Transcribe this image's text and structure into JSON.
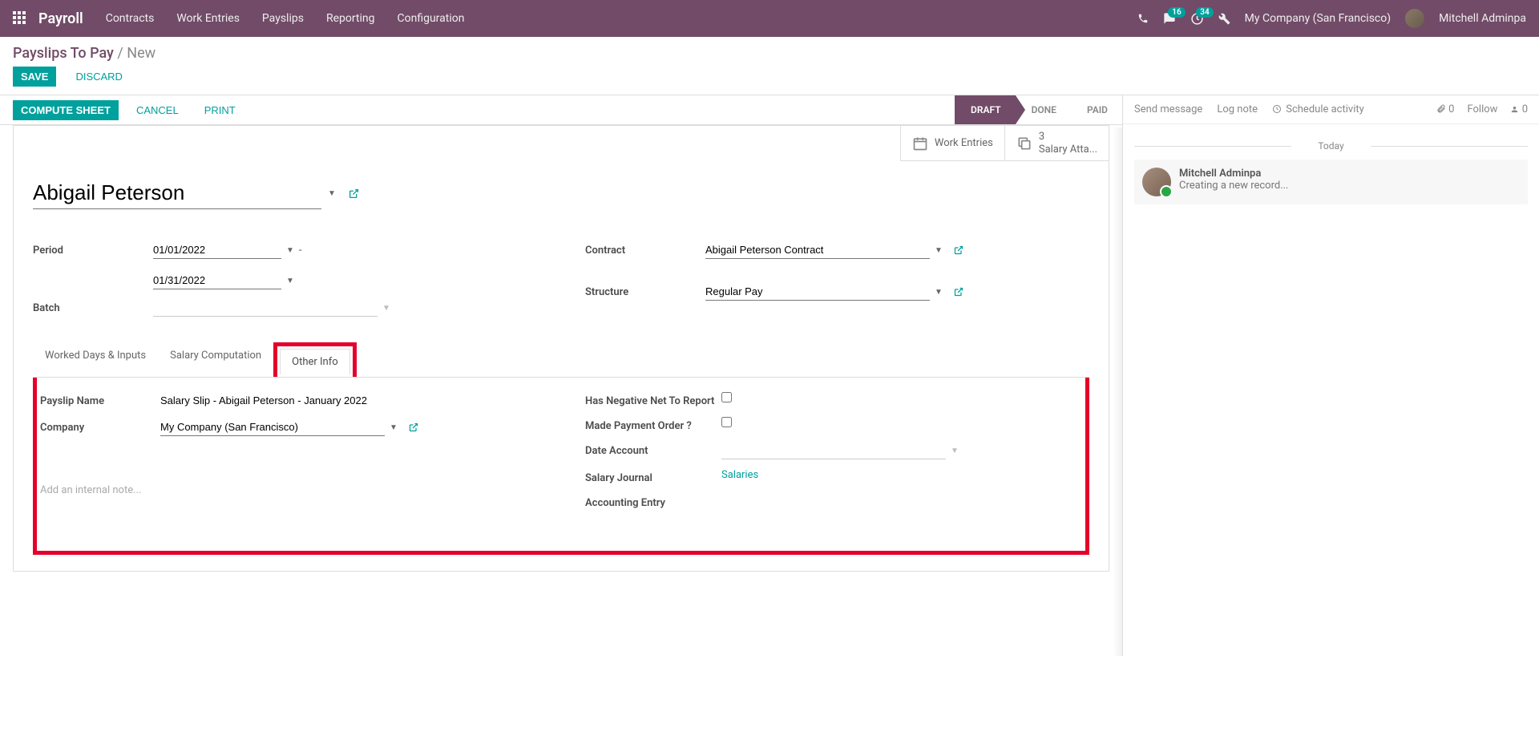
{
  "topbar": {
    "app_title": "Payroll",
    "menu": [
      "Contracts",
      "Work Entries",
      "Payslips",
      "Reporting",
      "Configuration"
    ],
    "msg_badge": "16",
    "call_badge": "34",
    "company": "My Company (San Francisco)",
    "user": "Mitchell Adminpa"
  },
  "breadcrumb": {
    "root": "Payslips To Pay",
    "current": "New"
  },
  "actions": {
    "save": "SAVE",
    "discard": "DISCARD"
  },
  "statusbar": {
    "compute": "COMPUTE SHEET",
    "cancel": "CANCEL",
    "print": "PRINT",
    "steps": [
      "DRAFT",
      "DONE",
      "PAID"
    ]
  },
  "stat_buttons": {
    "work_entries": "Work Entries",
    "salary_att_count": "3",
    "salary_att_label": "Salary Atta..."
  },
  "form": {
    "employee": "Abigail Peterson",
    "labels": {
      "period": "Period",
      "batch": "Batch",
      "contract": "Contract",
      "structure": "Structure"
    },
    "period_from": "01/01/2022",
    "period_to": "01/31/2022",
    "batch": "",
    "contract": "Abigail Peterson Contract",
    "structure": "Regular Pay"
  },
  "tabs": [
    "Worked Days & Inputs",
    "Salary Computation",
    "Other Info"
  ],
  "other_info": {
    "labels": {
      "payslip_name": "Payslip Name",
      "company": "Company",
      "neg_net": "Has Negative Net To Report",
      "payment_order": "Made Payment Order ?",
      "date_account": "Date Account",
      "salary_journal": "Salary Journal",
      "acct_entry": "Accounting Entry"
    },
    "payslip_name": "Salary Slip - Abigail Peterson - January 2022",
    "company": "My Company (San Francisco)",
    "salary_journal": "Salaries",
    "note_placeholder": "Add an internal note..."
  },
  "chatter": {
    "send": "Send message",
    "log": "Log note",
    "schedule": "Schedule activity",
    "attach_count": "0",
    "follow": "Follow",
    "follower_count": "0",
    "date": "Today",
    "msg_author": "Mitchell Adminpa",
    "msg_text": "Creating a new record..."
  }
}
